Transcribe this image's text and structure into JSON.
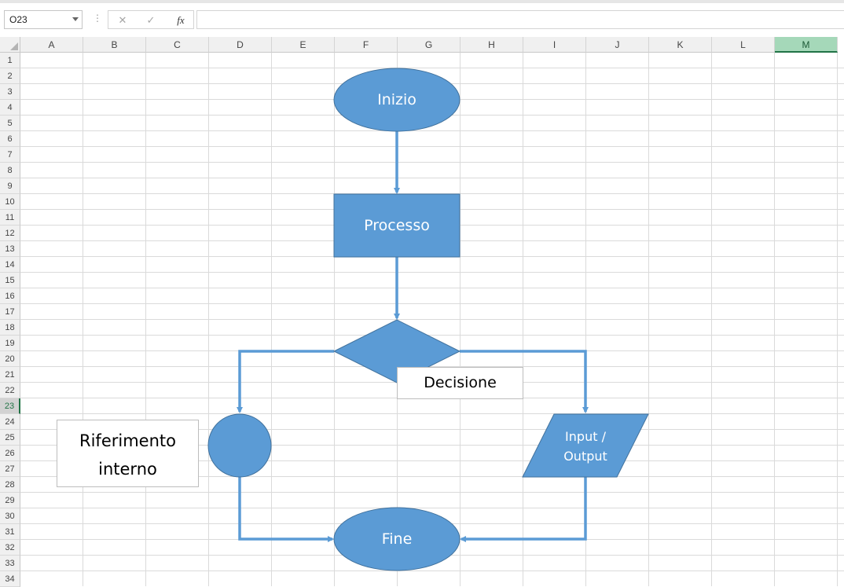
{
  "formula_bar": {
    "name_box": "O23",
    "cancel_glyph": "✕",
    "enter_glyph": "✓",
    "fx_label": "fx",
    "formula": ""
  },
  "columns": [
    "A",
    "B",
    "C",
    "D",
    "E",
    "F",
    "G",
    "H",
    "I",
    "J",
    "K",
    "L",
    "M"
  ],
  "selected_column": "M",
  "rows": [
    "1",
    "2",
    "3",
    "4",
    "5",
    "6",
    "7",
    "8",
    "9",
    "10",
    "11",
    "12",
    "13",
    "14",
    "15",
    "16",
    "17",
    "18",
    "19",
    "20",
    "21",
    "22",
    "23",
    "24",
    "25",
    "26",
    "27",
    "28",
    "29",
    "30",
    "31",
    "32",
    "33",
    "34"
  ],
  "selected_row": "23",
  "colors": {
    "shape_fill": "#5b9bd5",
    "shape_stroke": "#41719c",
    "connector": "#5b9bd5",
    "selection_accent": "#217346"
  },
  "flowchart": {
    "start_label": "Inizio",
    "process_label": "Processo",
    "decision_label": "Decisione",
    "io_label_line1": "Input /",
    "io_label_line2": "Output",
    "end_label": "Fine",
    "reference_line1": "Riferimento",
    "reference_line2": "interno"
  }
}
